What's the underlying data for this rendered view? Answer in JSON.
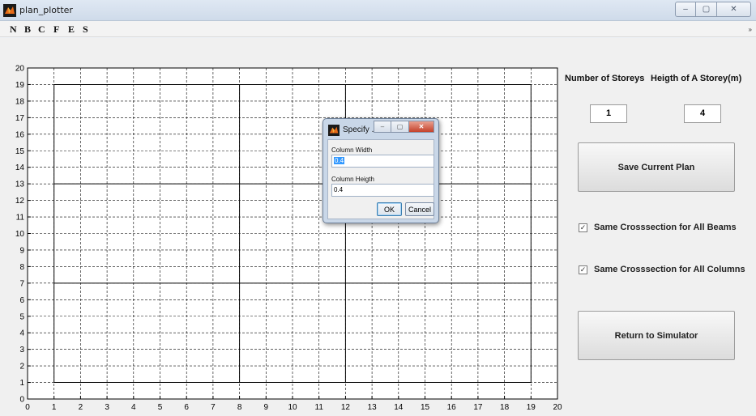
{
  "window": {
    "title": "plan_plotter",
    "caption_min": "–",
    "caption_max": "▢",
    "caption_close": "✕"
  },
  "menubar": {
    "items": [
      "N",
      "B",
      "C",
      "F",
      "E",
      "S"
    ],
    "overflow_arrow": "»"
  },
  "plot": {
    "x_ticks": [
      "0",
      "1",
      "2",
      "3",
      "4",
      "5",
      "6",
      "7",
      "8",
      "9",
      "10",
      "11",
      "12",
      "13",
      "14",
      "15",
      "16",
      "17",
      "18",
      "19",
      "20"
    ],
    "y_ticks": [
      "0",
      "1",
      "2",
      "3",
      "4",
      "5",
      "6",
      "7",
      "8",
      "9",
      "10",
      "11",
      "12",
      "13",
      "14",
      "15",
      "16",
      "17",
      "18",
      "19",
      "20"
    ],
    "xlim": [
      0,
      20
    ],
    "ylim": [
      0,
      20
    ],
    "grid": "dashed",
    "solid_x_lines": [
      1,
      8,
      12,
      19
    ],
    "solid_y_lines": [
      1,
      7,
      13,
      19
    ]
  },
  "panel": {
    "storeys_label": "Number of Storeys",
    "storey_height_label": "Heigth of A Storey(m)",
    "storeys_value": "1",
    "storey_height_value": "4",
    "save_button": "Save Current Plan",
    "beams_checkbox": "Same Crosssection for All Beams",
    "beams_checked": true,
    "columns_checkbox": "Same Crosssection for All Columns",
    "columns_checked": true,
    "return_button": "Return to Simulator"
  },
  "dialog": {
    "title": "Specify ...",
    "column_width_label": "Column Width",
    "column_width_value": "0.4",
    "column_height_label": "Column Heigth",
    "column_height_value": "0.4",
    "ok": "OK",
    "cancel": "Cancel"
  },
  "colors": {
    "window_bg": "#f0f0f0",
    "dialog_frame": "#c9d7e8",
    "selection": "#3399ff"
  }
}
